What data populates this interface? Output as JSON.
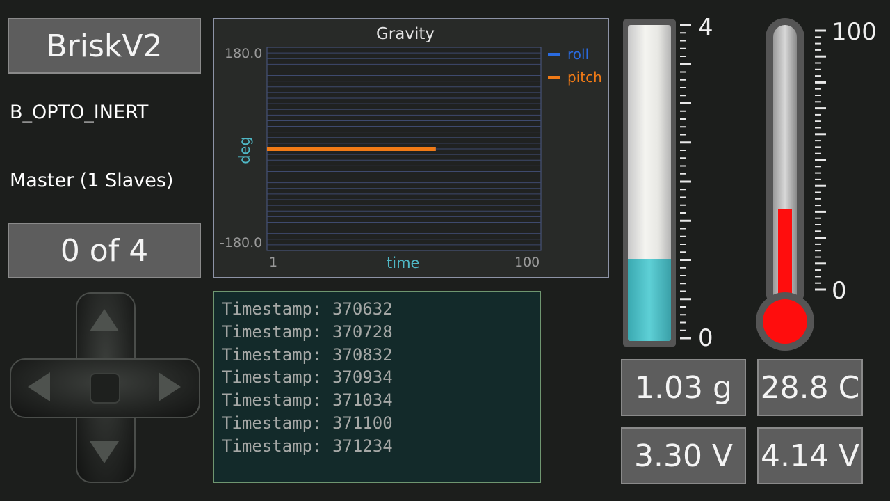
{
  "header": {
    "device_name": "BriskV2",
    "device_type": "B_OPTO_INERT",
    "master_status": "Master (1 Slaves)",
    "device_count": "0 of 4"
  },
  "chart": {
    "title": "Gravity",
    "ylabel": "deg",
    "xlabel": "time",
    "ytick_top": "180.0",
    "ytick_bottom": "-180.0",
    "xtick_left": "1",
    "xtick_right": "100",
    "legend": [
      {
        "name": "roll",
        "color": "#2a6be0"
      },
      {
        "name": "pitch",
        "color": "#f07a16"
      }
    ]
  },
  "chart_data": {
    "type": "line",
    "title": "Gravity",
    "xlabel": "time",
    "ylabel": "deg",
    "xlim": [
      1,
      100
    ],
    "ylim": [
      -180,
      180
    ],
    "grid": true,
    "legend_position": "right",
    "series": [
      {
        "name": "roll",
        "color": "#2a6be0",
        "x": [
          1,
          62
        ],
        "y": [
          0,
          0
        ]
      },
      {
        "name": "pitch",
        "color": "#f07a16",
        "x": [
          1,
          62
        ],
        "y": [
          0,
          0
        ]
      }
    ]
  },
  "log": {
    "lines": [
      "Timestamp: 370632",
      "Timestamp: 370728",
      "Timestamp: 370832",
      "Timestamp: 370934",
      "Timestamp: 371034",
      "Timestamp: 371100",
      "Timestamp: 371234"
    ]
  },
  "gauge": {
    "max_label": "4",
    "min_label": "0",
    "level_fraction": 0.26,
    "fill_color": "#4cc0c8"
  },
  "thermometer": {
    "max_label": "100",
    "min_label": "0",
    "level_fraction": 0.288,
    "fill_color": "#ff0d0d"
  },
  "readouts": {
    "accel": "1.03 g",
    "temperature": "28.8 C",
    "voltage1": "3.30 V",
    "voltage2": "4.14 V"
  }
}
